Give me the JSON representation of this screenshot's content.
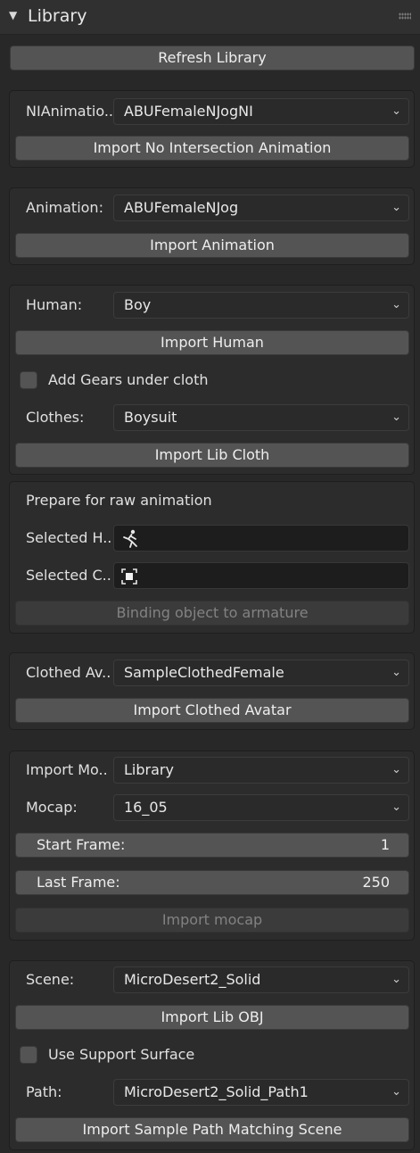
{
  "header": {
    "title": "Library"
  },
  "refresh_button": "Refresh Library",
  "ni_animation": {
    "label": "NIAnimatio..",
    "value": "ABUFemaleNJogNI",
    "button": "Import No Intersection Animation"
  },
  "animation": {
    "label": "Animation:",
    "value": "ABUFemaleNJog",
    "button": "Import Animation"
  },
  "human": {
    "label": "Human:",
    "value": "Boy",
    "button": "Import Human",
    "gears_checkbox_label": "Add Gears under cloth",
    "gears_checked": false,
    "clothes_label": "Clothes:",
    "clothes_value": "Boysuit",
    "clothes_button": "Import Lib Cloth"
  },
  "raw_animation": {
    "heading": "Prepare for raw animation",
    "selected_human_label": "Selected H..",
    "selected_human_icon": "armature-human-icon",
    "selected_cloth_label": "Selected C..",
    "selected_cloth_icon": "object-icon",
    "bind_button": "Binding object to armature"
  },
  "clothed_avatar": {
    "label": "Clothed Av..",
    "value": "SampleClothedFemale",
    "button": "Import Clothed Avatar"
  },
  "mocap": {
    "import_mode_label": "Import Mo..",
    "import_mode_value": "Library",
    "mocap_label": "Mocap:",
    "mocap_value": "16_05",
    "start_frame_label": "Start Frame:",
    "start_frame_value": "1",
    "last_frame_label": "Last Frame:",
    "last_frame_value": "250",
    "import_button": "Import mocap"
  },
  "scene": {
    "label": "Scene:",
    "value": "MicroDesert2_Solid",
    "button": "Import Lib OBJ",
    "support_checkbox_label": "Use Support Surface",
    "support_checked": false,
    "path_label": "Path:",
    "path_value": "MicroDesert2_Solid_Path1",
    "path_button": "Import Sample Path Matching Scene"
  },
  "colors": {
    "background": "#282828",
    "panel": "#2c2c2c",
    "button": "#545454",
    "field": "#1d1d1d"
  }
}
